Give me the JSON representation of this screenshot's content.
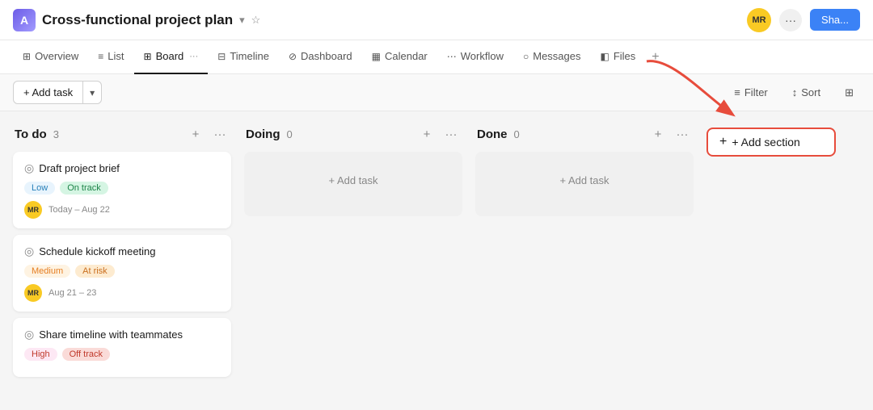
{
  "app": {
    "icon": "A",
    "project_title": "Cross-functional project plan",
    "dropdown_icon": "▾",
    "star_icon": "☆"
  },
  "top_bar": {
    "avatar_initials": "MR",
    "more_label": "···",
    "share_label": "Sha..."
  },
  "nav_tabs": [
    {
      "id": "overview",
      "label": "Overview",
      "icon": "⊞",
      "active": false
    },
    {
      "id": "list",
      "label": "List",
      "icon": "≡",
      "active": false
    },
    {
      "id": "board",
      "label": "Board",
      "icon": "⊞",
      "active": true
    },
    {
      "id": "timeline",
      "label": "Timeline",
      "icon": "⊟",
      "active": false
    },
    {
      "id": "dashboard",
      "label": "Dashboard",
      "icon": "⊘",
      "active": false
    },
    {
      "id": "calendar",
      "label": "Calendar",
      "icon": "▦",
      "active": false
    },
    {
      "id": "workflow",
      "label": "Workflow",
      "icon": "⋯",
      "active": false
    },
    {
      "id": "messages",
      "label": "Messages",
      "icon": "○",
      "active": false
    },
    {
      "id": "files",
      "label": "Files",
      "icon": "◧",
      "active": false
    }
  ],
  "toolbar": {
    "add_task_label": "+ Add task",
    "add_task_dropdown": "▾",
    "filter_label": "Filter",
    "filter_icon": "≡",
    "sort_label": "Sort",
    "sort_icon": "↕",
    "group_icon": "⊞"
  },
  "columns": [
    {
      "id": "todo",
      "title": "To do",
      "count": 3,
      "tasks": [
        {
          "id": "t1",
          "title": "Draft project brief",
          "tags": [
            {
              "label": "Low",
              "type": "low"
            },
            {
              "label": "On track",
              "type": "on-track"
            }
          ],
          "avatar": "MR",
          "date": "Today – Aug 22"
        },
        {
          "id": "t2",
          "title": "Schedule kickoff meeting",
          "tags": [
            {
              "label": "Medium",
              "type": "medium"
            },
            {
              "label": "At risk",
              "type": "at-risk"
            }
          ],
          "avatar": "MR",
          "date": "Aug 21 – 23"
        },
        {
          "id": "t3",
          "title": "Share timeline with teammates",
          "tags": [
            {
              "label": "High",
              "type": "high"
            },
            {
              "label": "Off track",
              "type": "off-track"
            }
          ],
          "avatar": null,
          "date": null
        }
      ]
    },
    {
      "id": "doing",
      "title": "Doing",
      "count": 0,
      "tasks": []
    },
    {
      "id": "done",
      "title": "Done",
      "count": 0,
      "tasks": []
    }
  ],
  "add_section": {
    "label": "+ Add section"
  }
}
